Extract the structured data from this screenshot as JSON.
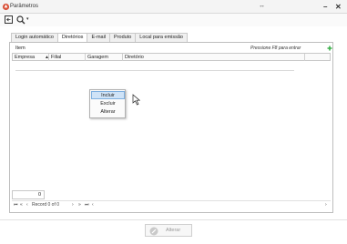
{
  "window": {
    "title": "Parâmetros",
    "maximize_glyph": "↔",
    "minimize_glyph": "–",
    "close_glyph": "✕"
  },
  "toolbar": {
    "icons": [
      "exit-icon",
      "search-icon",
      "chevron-down-icon"
    ],
    "dropdown_glyph": "▾"
  },
  "tabs": [
    {
      "label": "Login automático",
      "active": false
    },
    {
      "label": "Diretórios",
      "active": true
    },
    {
      "label": "E-mail",
      "active": false
    },
    {
      "label": "Produto",
      "active": false
    },
    {
      "label": "Local para emissão",
      "active": false
    }
  ],
  "group": {
    "label": "Item",
    "hint": "Pressione F8 para entrar"
  },
  "grid": {
    "columns": [
      "Empresa",
      "Filial",
      "Garagem",
      "Diretório"
    ],
    "sort_glyph": "▲"
  },
  "context_menu": {
    "items": [
      "Incluir",
      "Excluir",
      "Alterar"
    ],
    "hovered": "Incluir"
  },
  "footer_grid": {
    "count": "0",
    "record_text": "Record 0 of 0",
    "nav_first": "⏮",
    "nav_prev_page": "«",
    "nav_prev": "‹",
    "nav_next": "›",
    "nav_next_page": "»",
    "nav_last": "⏭",
    "scroll_left": "‹",
    "scroll_right": "›"
  },
  "actions": {
    "alter_label": "Alterar",
    "alter_enabled": false
  },
  "colors": {
    "add_icon": "#3bb04a",
    "app_icon": "#d9533b",
    "menu_hover": "#cfe3f7"
  }
}
